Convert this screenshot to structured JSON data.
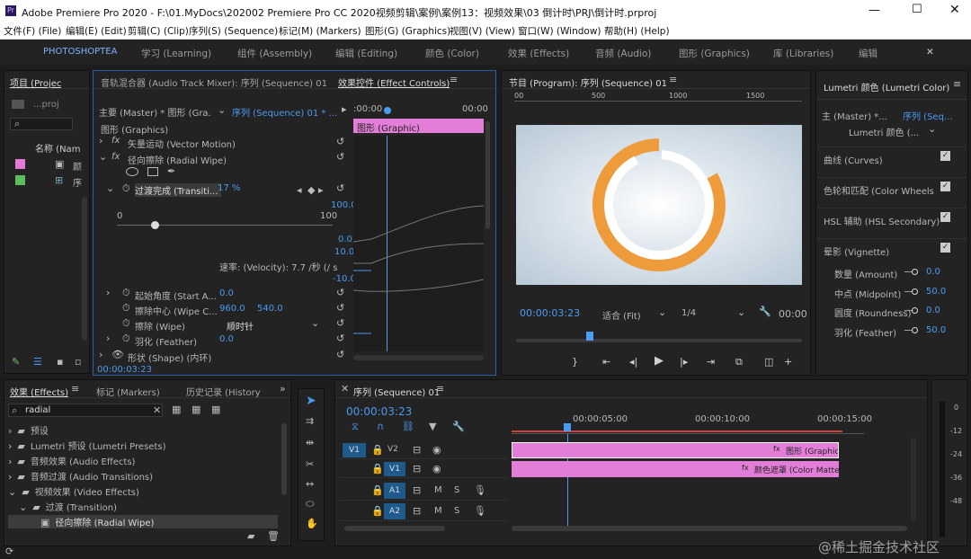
{
  "titlebar": {
    "title": "Adobe Premiere Pro 2020 - F:\\01.MyDocs\\202002 Premiere Pro CC 2020视频剪辑\\案例\\案例13：视频效果\\03 倒计时\\PRJ\\倒计时.prproj"
  },
  "menu": [
    "文件(F) (File)",
    "编辑(E) (Edit)",
    "剪辑(C) (Clip)",
    "序列(S) (Sequence)",
    "标记(M) (Markers)",
    "图形(G) (Graphics)",
    "视图(V) (View)",
    "窗口(W) (Window)",
    "帮助(H) (Help)"
  ],
  "workspaces": [
    "PHOTOSHOPTEA",
    "学习 (Learning)",
    "组件 (Assembly)",
    "编辑 (Editing)",
    "颜色 (Color)",
    "效果 (Effects)",
    "音频 (Audio)",
    "图形 (Graphics)",
    "库 (Libraries)",
    "编辑"
  ],
  "project": {
    "tab": "项目 (Projec",
    "file": "...proj",
    "col_name": "名称 (Nam",
    "items": [
      "颜",
      "序"
    ],
    "item_colors": [
      "#e478d6",
      "#5bbf5b"
    ]
  },
  "effect_controls": {
    "tab_mixer": "音轨混合器 (Audio Track Mixer): 序列 (Sequence) 01",
    "tab": "效果控件 (Effect Controls)",
    "master": "主要 (Master) * 图形 (Gra...",
    "seq": "序列 (Sequence) 01 * ...",
    "time_start": ":00:00",
    "time_end": "00:00",
    "clip_label": "图形 (Graphic)",
    "section": "图形 (Graphics)",
    "vector": "矢量运动 (Vector Motion)",
    "radial": "径向擦除 (Radial Wipe)",
    "prop_transition": "过渡完成 (Transiti...",
    "prop_transition_val": "17 %",
    "slider_min": "0",
    "slider_max": "100",
    "graph_top": "100.0",
    "graph_zero": "0.0",
    "graph_v1": "10.0",
    "graph_v2": "-10.0",
    "velocity": "速率: (Velocity): 7.7 /秒 (/ s",
    "start_angle": "起始角度 (Start A...",
    "start_angle_val": "0.0",
    "wipe_center": "擦除中心 (Wipe C...",
    "wipe_center_x": "960.0",
    "wipe_center_y": "540.0",
    "wipe": "擦除 (Wipe)",
    "wipe_val": "顺时针",
    "feather": "羽化 (Feather)",
    "feather_val": "0.0",
    "shape": "形状 (Shape) (内环)",
    "timecode": "00:00:03:23"
  },
  "program": {
    "tab": "节目 (Program): 序列 (Sequence) 01",
    "ruler": [
      "00",
      "500",
      "1000",
      "1500"
    ],
    "timecode": "00:00:03:23",
    "fit": "适合 (Fit)",
    "quality": "1/4",
    "timecode_right": "00:00",
    "ring_colors": {
      "orange": "#ee9b3c",
      "white": "#ffffff",
      "bg": "#c6d4df"
    },
    "ring_progress": 0.17
  },
  "lumetri": {
    "tab": "Lumetri 颜色 (Lumetri Color)",
    "master": "主 (Master) *...",
    "seq": "序列 (Seq...",
    "fx": "Lumetri 颜色 (...",
    "sections": [
      "曲线 (Curves)",
      "色轮和匹配 (Color Wheels & ...tc",
      "HSL 辅助 (HSL Secondary)",
      "晕影 (Vignette)"
    ],
    "params": [
      {
        "label": "数量 (Amount)",
        "val": "0.0"
      },
      {
        "label": "中点 (Midpoint)",
        "val": "50.0"
      },
      {
        "label": "圆度 (Roundness)",
        "val": "0.0"
      },
      {
        "label": "羽化 (Feather)",
        "val": "50.0"
      }
    ]
  },
  "effects": {
    "tab_effects": "效果 (Effects)",
    "tab_markers": "标记 (Markers)",
    "tab_history": "历史记录 (History",
    "search": "radial",
    "tree": [
      "预设",
      "Lumetri 预设 (Lumetri Presets)",
      "音频效果 (Audio Effects)",
      "音频过渡 (Audio Transitions)",
      "视频效果 (Video Effects)",
      "过渡 (Transition)",
      "径向擦除 (Radial Wipe)"
    ]
  },
  "timeline": {
    "tab": "序列 (Sequence) 01",
    "timecode": "00:00:03:23",
    "ruler": [
      "00:00:05:00",
      "00:00:10:00",
      "00:00:15:00"
    ],
    "tracks": [
      "V2",
      "V1",
      "A1",
      "A2"
    ],
    "clip_v2": "图形 (Graphic",
    "clip_v1": "颜色遮罩 (Color Matte)",
    "clip_color": "#e37ed8",
    "audio_db": [
      "0",
      "-12",
      "-24",
      "-36",
      "-48"
    ]
  },
  "watermark": "@稀土掘金技术社区"
}
